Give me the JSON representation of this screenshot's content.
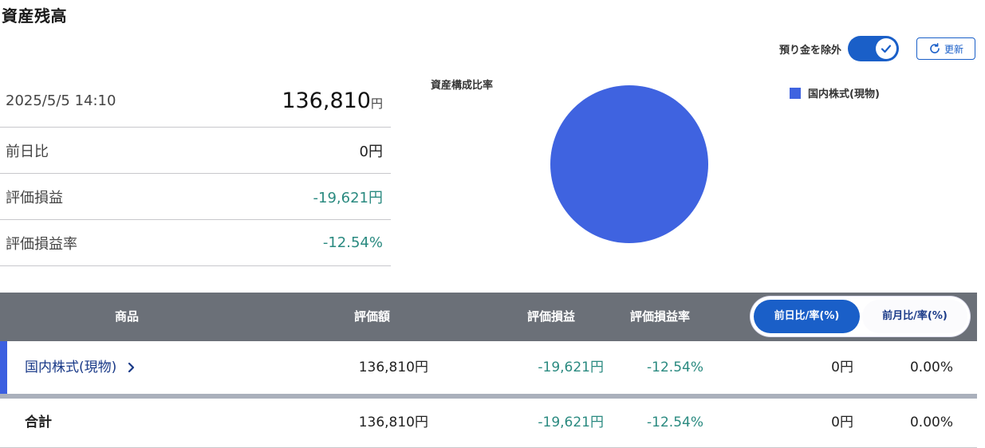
{
  "header": {
    "title": "資産残高"
  },
  "controls": {
    "toggle_label": "預り金を除外",
    "toggle_on": true,
    "refresh_label": "更新"
  },
  "summary": {
    "datetime": "2025/5/5 14:10",
    "total_value": "136,810",
    "total_unit": "円",
    "rows": [
      {
        "label": "前日比",
        "value": "0円"
      },
      {
        "label": "評価損益",
        "value": "-19,621円"
      },
      {
        "label": "評価損益率",
        "value": "-12.54%"
      }
    ]
  },
  "chart_data": {
    "type": "pie",
    "title": "資産構成比率",
    "series": [
      {
        "name": "国内株式(現物)",
        "value": 100,
        "color": "#3f63e0"
      }
    ],
    "legend_position": "top-right"
  },
  "table": {
    "headers": {
      "product": "商品",
      "value": "評価額",
      "pl": "評価損益",
      "pl_rate": "評価損益率"
    },
    "segment": {
      "active": "前日比/率(%)",
      "inactive": "前月比/率(%)"
    },
    "rows": [
      {
        "product": "国内株式(現物)",
        "value": "136,810円",
        "pl": "-19,621円",
        "pl_rate": "-12.54%",
        "change": "0円",
        "change_rate": "0.00%"
      }
    ],
    "total": {
      "label": "合計",
      "value": "136,810円",
      "pl": "-19,621円",
      "pl_rate": "-12.54%",
      "change": "0円",
      "change_rate": "0.00%"
    }
  }
}
